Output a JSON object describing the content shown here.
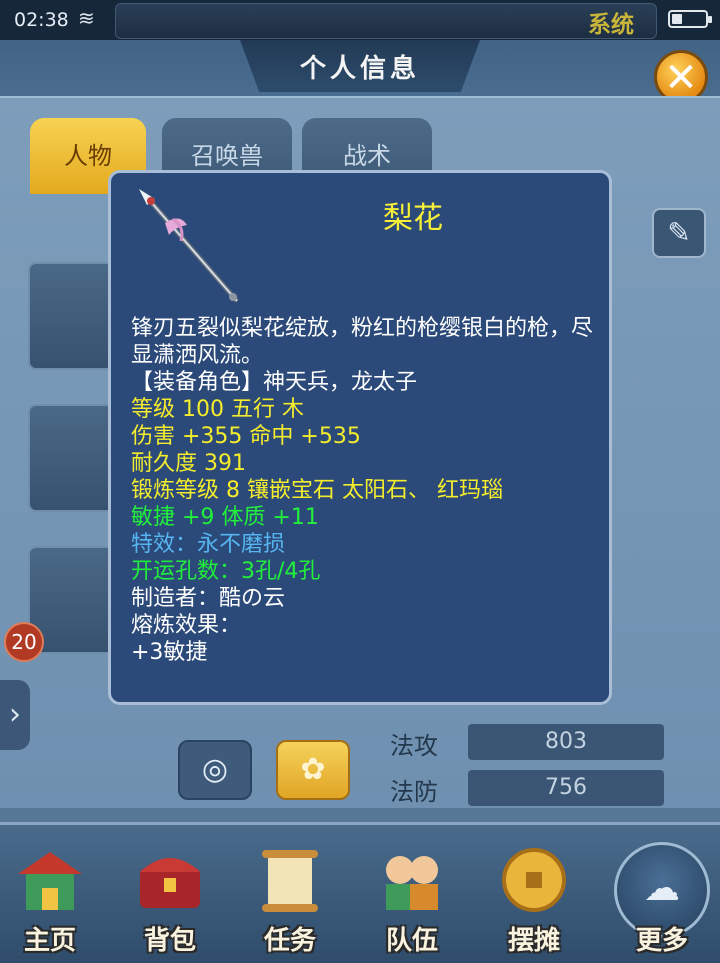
{
  "status_bar": {
    "time": "02:38",
    "system_label": "系统"
  },
  "header": {
    "title": "个人信息",
    "close_symbol": "✕"
  },
  "tabs": [
    {
      "label": "人物",
      "active": true
    },
    {
      "label": "召唤兽",
      "active": false
    },
    {
      "label": "战术",
      "active": false
    }
  ],
  "character": {
    "level": "20"
  },
  "stats": [
    {
      "label": "法攻",
      "value": "803"
    },
    {
      "label": "法防",
      "value": "756"
    }
  ],
  "tooltip": {
    "item_name": "梨花",
    "description": "锋刃五裂似梨花绽放，粉红的枪缨银白的枪，尽显潇洒风流。",
    "equip_roles": "【装备角色】神天兵，龙太子",
    "level_line": "等级 100  五行 木",
    "damage_line": "伤害 +355 命中 +535",
    "durability_line": "耐久度 391",
    "forge_line": "锻炼等级 8  镶嵌宝石 太阳石、 红玛瑙",
    "bonus_line": "敏捷 +9 体质 +11",
    "special_line": "特效：永不磨损",
    "holes_line": "开运孔数：3孔/4孔",
    "maker_line": "制造者：酷の云",
    "smelt_label": "熔炼效果：",
    "smelt_value": "+3敏捷",
    "colors": {
      "name": "#f7ee37",
      "white": "#ffffff",
      "yellow": "#f4ec2c",
      "green": "#22ef3b",
      "blue": "#56b5f0"
    }
  },
  "bottom_nav": [
    {
      "label": "主页",
      "icon": "palace-icon"
    },
    {
      "label": "背包",
      "icon": "chest-icon"
    },
    {
      "label": "任务",
      "icon": "scroll-icon"
    },
    {
      "label": "队伍",
      "icon": "team-icon"
    },
    {
      "label": "摆摊",
      "icon": "coin-icon"
    },
    {
      "label": "更多",
      "icon": "more-icon"
    }
  ]
}
